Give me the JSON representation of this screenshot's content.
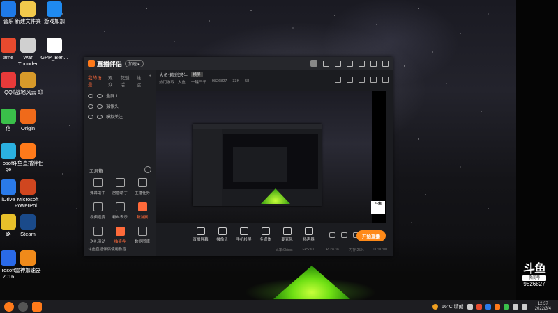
{
  "desktop": {
    "icons": [
      {
        "name": "music-app-icon",
        "label": "音乐",
        "color": "#1f7ae8"
      },
      {
        "name": "new-folder-icon",
        "label": "新建文件夹",
        "color": "#f2c94c"
      },
      {
        "name": "game-accelerator-icon",
        "label": "游戏加加",
        "color": "#1f8af0"
      },
      {
        "name": "game-app-icon",
        "label": "ame",
        "color": "#e84a2e"
      },
      {
        "name": "war-thunder-icon",
        "label": "War\nThunder",
        "color": "#d0d0d0"
      },
      {
        "name": "gpp-file-icon",
        "label": "GPP_Ben...",
        "color": "#ffffff"
      },
      {
        "name": "qq-icon",
        "label": "QQ",
        "color": "#e83a3a"
      },
      {
        "name": "game-zhandi-icon",
        "label": "《战地风云 5》",
        "color": "#d89a2a"
      },
      {
        "name": "wechat-icon",
        "label": "信",
        "color": "#3ac04a"
      },
      {
        "name": "origin-icon",
        "label": "Origin",
        "color": "#f06a1a"
      },
      {
        "name": "edge-icon",
        "label": "osoft\nge",
        "color": "#2bb0e0"
      },
      {
        "name": "douyu-companion-icon",
        "label": "斗鱼直播伴侣",
        "color": "#ff7a1a"
      },
      {
        "name": "onedrive-icon",
        "label": "iDrive",
        "color": "#2a7ae8"
      },
      {
        "name": "powerpoint-icon",
        "label": "Microsoft\nPowerPoi...",
        "color": "#d0461f"
      },
      {
        "name": "game-icon-2",
        "label": "路",
        "color": "#e8c02a"
      },
      {
        "name": "steam-icon",
        "label": "Steam",
        "color": "#1a4a8a"
      },
      {
        "name": "office-icon",
        "label": "rosoft\n2016",
        "color": "#2a6ae8"
      },
      {
        "name": "leishen-icon",
        "label": "雷神加速器",
        "color": "#f08a1a"
      }
    ]
  },
  "app": {
    "title": "直播伴侣",
    "version_badge": "加速 ▸",
    "sidebar_tabs": [
      "我的场景",
      "观众",
      "花魁活",
      "维运"
    ],
    "scenes": [
      "全屏 1",
      "摄像头",
      "模拟关注"
    ],
    "toolbox_title": "工具箱",
    "tools": [
      {
        "name": "tool-stream-assistant",
        "label": "弹幕助手",
        "hot": false
      },
      {
        "name": "tool-room-manager",
        "label": "房管助手",
        "hot": false
      },
      {
        "name": "tool-tasks",
        "label": "主播任务",
        "hot": false
      },
      {
        "name": "tool-pk",
        "label": "视频连麦",
        "hot": false
      },
      {
        "name": "tool-fans",
        "label": "粉丝表示",
        "hot": false
      },
      {
        "name": "tool-game",
        "label": "新游赛",
        "hot": true
      },
      {
        "name": "tool-activity",
        "label": "送礼活动",
        "hot": false
      },
      {
        "name": "tool-lottery",
        "label": "抽奖券",
        "hot": true
      },
      {
        "name": "tool-data",
        "label": "数据图库",
        "hot": false
      }
    ],
    "hint": "斗鱼直播伴侣使用教程",
    "room": {
      "title": "大鱼*精彩求生",
      "badge": "横屏",
      "category": "热门游戏 · 大鱼",
      "sub1": "一键三千",
      "room_id": "9826827",
      "heat": "33K",
      "fans": "58"
    },
    "controls": [
      {
        "name": "direct-screen-button",
        "label": "直播屏幕"
      },
      {
        "name": "camera-button",
        "label": "摄像头"
      },
      {
        "name": "phone-screen-button",
        "label": "手机投屏"
      },
      {
        "name": "multi-media-button",
        "label": "多媒体"
      },
      {
        "name": "mic-button",
        "label": "麦克风"
      },
      {
        "name": "speaker-button",
        "label": "扬声器"
      }
    ],
    "start_button": "开始直播",
    "status": [
      "码率:0kbps",
      "FPS:60",
      "CPU:87%",
      "内存:25%",
      "00:00:00"
    ],
    "preview_watermark": "斗鱼"
  },
  "watermark": {
    "brand": "斗鱼",
    "room_label": "房间号",
    "room_number": "9826827"
  },
  "taskbar": {
    "weather": "16°C 晴朗",
    "time": "12:37",
    "date": "2022/3/4"
  }
}
